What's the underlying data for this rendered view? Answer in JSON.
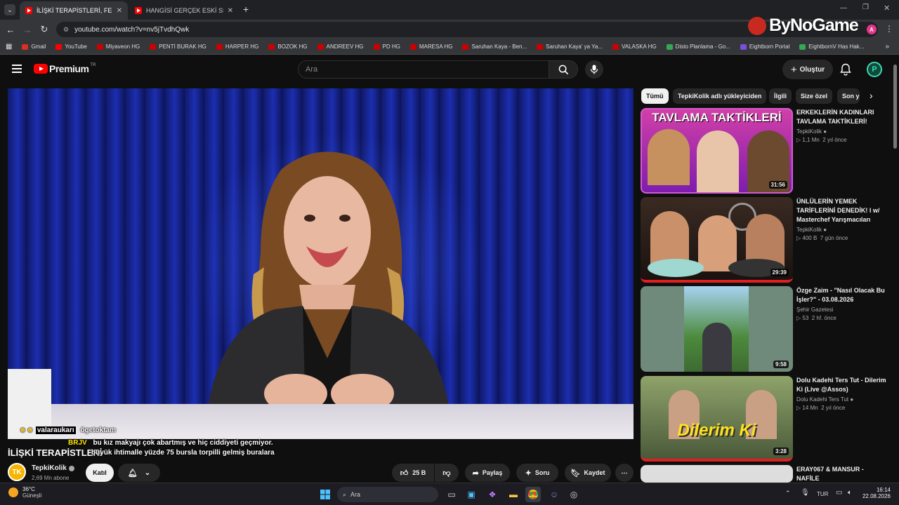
{
  "browser": {
    "tabs": [
      {
        "title": "İLİŞKİ TERAPİSTLERİ, FENOMENL",
        "active": true
      },
      {
        "title": "HANGİSİ GERÇEK ESKİ SEVGİLİS",
        "active": false
      }
    ],
    "url": "youtube.com/watch?v=nv5jTvdhQwk",
    "bookmarks": [
      "Gmail",
      "YouTube",
      "Miyaveon HG",
      "PENTİ BURAK HG",
      "HARPER HG",
      "BOZOK HG",
      "ANDREEV HG",
      "PD HG",
      "MARESA HG",
      "Saruhan Kaya - Ben...",
      "Saruhan Kaya' ya Ya...",
      "VALASKA HG",
      "Disto Planlama - Go...",
      "Eightborn Portal",
      "EightbornV Has Hak..."
    ],
    "watermark": "ByNoGame",
    "profile_initial": "A"
  },
  "header": {
    "logo": "Premium",
    "region": "TR",
    "search_placeholder": "Ara",
    "create_label": "Oluştur"
  },
  "video": {
    "title": "İLİŞKİ TERAPİSTLERİ",
    "chat": [
      {
        "user": "valaraukarı",
        "text": "ögetoktam"
      },
      {
        "user": "BRJV",
        "text": "bu kız makyajı çok abartmış ve hiç ciddiyeti geçmiyor."
      },
      {
        "user": "",
        "text": "büyük ihtimalle yüzde 75 bursla torpilli gelmiş buralara"
      }
    ]
  },
  "channel": {
    "name": "TepkiKolik",
    "subscribers": "2,69 Mn abone",
    "join_label": "Katıl"
  },
  "actions": {
    "likes": "25 B",
    "share": "Paylaş",
    "ask": "Soru",
    "save": "Kaydet"
  },
  "chips": [
    "Tümü",
    "TepkiKolik adlı yükleyiciden",
    "İlgili",
    "Size özel",
    "Son y"
  ],
  "recommendations": [
    {
      "title": "ERKEKLERİN KADINLARI TAVLAMA TAKTİKLERİ!",
      "channel": "TepkiKolik",
      "verified": true,
      "views": "1,1 Mn",
      "age": "2 yıl önce",
      "duration": "31:56",
      "thumb_text": "TAVLAMA TAKTİKLERİ"
    },
    {
      "title": "ÜNLÜLERİN YEMEK TARİFLERİNİ DENEDİK! l w/ Masterchef Yarışmacıları",
      "channel": "TepkiKolik",
      "verified": true,
      "views": "400 B",
      "age": "7 gün önce",
      "duration": "29:39",
      "thumb_text": ""
    },
    {
      "title": "Özge Zaim - \"Nasıl Olacak Bu İşler?\" - 03.08.2026",
      "channel": "Şehir Gazetesi",
      "verified": false,
      "views": "53",
      "age": "2 hf. önce",
      "duration": "9:58",
      "thumb_text": ""
    },
    {
      "title": "Dolu Kadehi Ters Tut - Dilerim Ki (Live @Assos)",
      "channel": "Dolu Kadehi Ters Tut",
      "verified": true,
      "views": "14 Mn",
      "age": "2 yıl önce",
      "duration": "3:28",
      "thumb_text": "Dilerim Ki"
    },
    {
      "title": "ERAY067 & MANSUR - NAFİLE",
      "channel": "",
      "verified": false,
      "views": "",
      "age": "",
      "duration": "",
      "thumb_text": ""
    }
  ],
  "taskbar": {
    "temp": "36°C",
    "weather": "Güneşli",
    "search": "Ara",
    "lang": "TUR",
    "time": "16:14",
    "date": "22.08.2026"
  },
  "colors": {
    "accent_red": "#ff0000",
    "chip_active": "#f1f1f1",
    "bg": "#0f0f0f"
  }
}
